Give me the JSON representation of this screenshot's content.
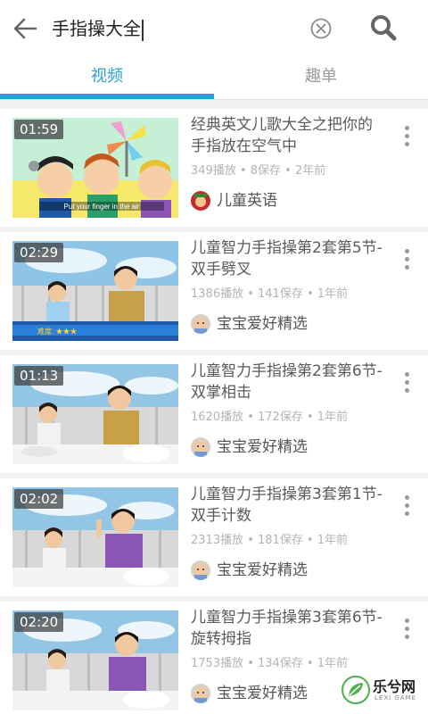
{
  "search": {
    "query": "手指操大全"
  },
  "tabs": [
    {
      "label": "视频",
      "active": true
    },
    {
      "label": "趣单",
      "active": false
    }
  ],
  "videos": [
    {
      "duration": "01:59",
      "title": "经典英文儿歌大全之把你的手指放在空气中",
      "stats": "349播放 • 8保存 • 2年前",
      "channel": "儿童英语",
      "thumb_caption": "Put your finger in the air"
    },
    {
      "duration": "02:29",
      "title": "儿童智力手指操第2套第5节-双手劈叉",
      "stats": "1386播放 • 141保存 • 1年前",
      "channel": "宝宝爱好精选",
      "thumb_caption": "难度: ★★★"
    },
    {
      "duration": "01:13",
      "title": "儿童智力手指操第2套第6节-双掌相击",
      "stats": "1620播放 • 172保存 • 1年前",
      "channel": "宝宝爱好精选"
    },
    {
      "duration": "02:02",
      "title": "儿童智力手指操第3套第1节-双手计数",
      "stats": "2313播放 • 181保存 • 1年前",
      "channel": "宝宝爱好精选"
    },
    {
      "duration": "02:20",
      "title": "儿童智力手指操第3套第6节-旋转拇指",
      "stats": "1753播放 • 134保存 • 1年前",
      "channel": "宝宝爱好精选"
    }
  ],
  "watermark": {
    "text": "乐兮网",
    "sub": "LEXI GAME"
  },
  "colors": {
    "accent": "#2a9fd8",
    "title_text": "#5a5a5a",
    "meta_text": "#b4b4b4"
  },
  "icons": [
    "back-arrow-icon",
    "clear-icon",
    "search-icon",
    "more-vertical-icon"
  ]
}
